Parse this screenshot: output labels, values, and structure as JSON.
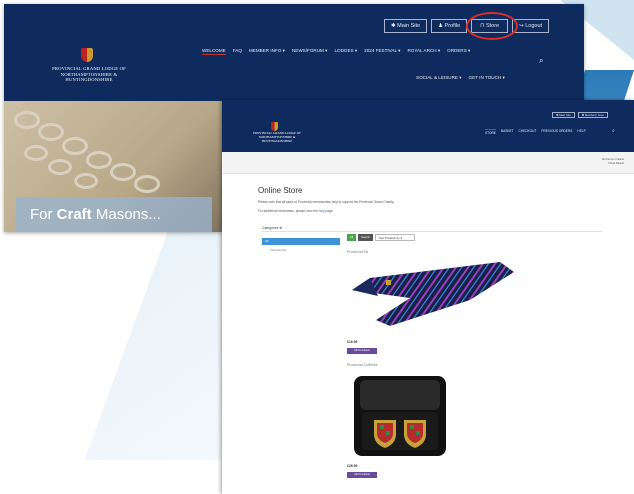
{
  "back": {
    "logo_text": [
      "PROVINCIAL GRAND LODGE OF",
      "NORTHAMPTONSHIRE &",
      "HUNTINGDONSHIRE"
    ],
    "top_buttons": [
      "✱ Main Site",
      "♟ Profile",
      "⊓ Store",
      "↪ Logout"
    ],
    "nav_row1": [
      "WELCOME",
      "FAQ",
      "MEMBER INFO ▾",
      "NEWS/FORUM ▾",
      "LODGES ▾",
      "2024 FESTIVAL ▾",
      "ROYAL ARCH ▾",
      "ORDERS ▾"
    ],
    "nav_row2": [
      "SOCIAL & LEISURE ▾",
      "GET IN TOUCH ▾"
    ],
    "hero_caption_pre": "For ",
    "hero_caption_bold": "Craft",
    "hero_caption_post": " Masons..."
  },
  "front": {
    "logo_text": [
      "PROVINCIAL GRAND LODGE OF",
      "NORTHAMPTONSHIRE &",
      "HUNTINGDONSHIRE"
    ],
    "top_buttons": [
      "✱ Main Site",
      "✱ Members' Area"
    ],
    "nav": [
      "STORE",
      "BASKET",
      "CHECKOUT",
      "PREVIOUS ORDERS",
      "HELP"
    ],
    "strip_line1": "Not Items in basket",
    "strip_line2": "Check Basket",
    "title": "Online Store",
    "para1": "Please note that all sales of Provincial merchandise help to support the Provincial Grand Charity.",
    "para2_pre": "For additional information, please view the ",
    "para2_link": "help",
    "para2_post": " page.",
    "categories_label": "Categories ⊕",
    "category_selected": "All",
    "category_sub": "– Merchandise",
    "filter_btn1": "All",
    "filter_btn2": "Search",
    "filter_select": "Sort Products by",
    "products": [
      {
        "name": "Provincial Tie",
        "price": "£16.99",
        "button": "Add to basket"
      },
      {
        "name": "Provincial Cufflinks",
        "price": "£26.99",
        "button": "Add to basket"
      }
    ]
  },
  "colors": {
    "navy": "#0f2a5c",
    "circle": "#d6302b",
    "accent": "#3d93d6",
    "button": "#6a4a9a"
  },
  "icons": [
    "search-icon",
    "crest-icon",
    "store-icon"
  ]
}
